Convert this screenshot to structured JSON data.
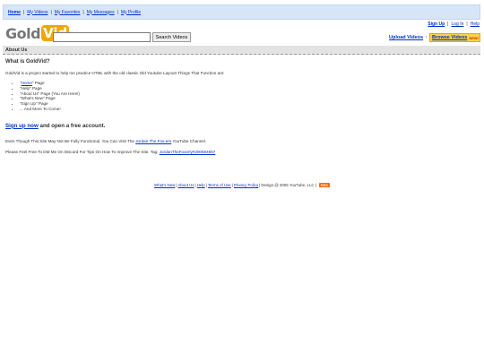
{
  "topnav": {
    "items": [
      "Home",
      "My Videos",
      "My Favorites",
      "My Messages",
      "My Profile"
    ]
  },
  "userlinks": {
    "signup": "Sign Up",
    "login": "Log In",
    "help": "Help"
  },
  "logo": {
    "part1": "Gold",
    "part2": "Vid"
  },
  "search": {
    "value": "",
    "button": "Search Videos"
  },
  "upload": {
    "label": "Upload Videos"
  },
  "browse": {
    "label": "Browse Videos",
    "badge": "NEW!"
  },
  "section": {
    "title": "About Us"
  },
  "content": {
    "heading": "What is GoldVid?",
    "intro": "GoldVid is a project started to help me practice HTML with the old classic Old Youtube Layout! Things That Function are:",
    "list": [
      {
        "quote_open": "\"",
        "link": "Home",
        "rest": "\" Page"
      },
      {
        "text": "\"Help\" Page"
      },
      {
        "text": "\"About Us\" Page (You Are Here!)"
      },
      {
        "text": "\"What's New\" Page"
      },
      {
        "text": "\"Sign Up\" Page"
      },
      {
        "text": "... And More To Come!"
      }
    ],
    "signup_link": "Sign up now",
    "signup_rest": " and open a free account.",
    "p1_before": "Even Though This Site May Not Be Fully Functional, You Can Visit The ",
    "p1_link": "Jordan The Fox-ers",
    "p1_after": " YouTube Channel.",
    "p2_before": "Please Feel Free To DM Me On Discord For Tips On How To Improve The Site. Tag: ",
    "p2_link": "JordanTheFoxerly#200584657"
  },
  "footer": {
    "links": [
      "What's New",
      "About Us",
      "Help",
      "Terms of Use",
      "Privacy Policy"
    ],
    "text": "Design @ 2005 YouTube, LLC",
    "rss": "RSS"
  },
  "colors": {
    "nav_bg": "#d6e6f7",
    "link": "#0033cc",
    "logo_accent": "#f0a800",
    "browse_bg": "#f6d24a",
    "section_bg": "#e3e3e3",
    "rss": "#ff6600"
  },
  "icons": {
    "upload": "upload-arrow-icon"
  }
}
